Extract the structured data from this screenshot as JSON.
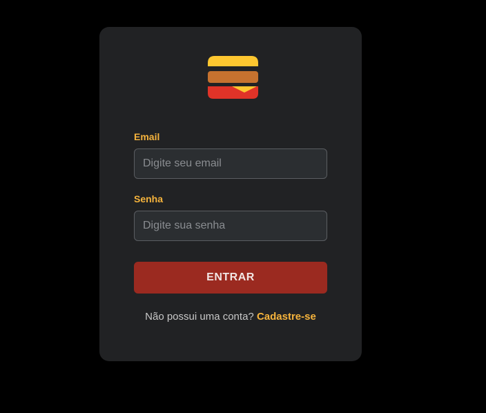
{
  "logo": {
    "icon": "burger-icon",
    "colors": {
      "bun_top": "#fdc730",
      "patty": "#c6722f",
      "cheese": "#fdc730",
      "bun_bottom": "#e03328"
    }
  },
  "form": {
    "email": {
      "label": "Email",
      "placeholder": "Digite seu email",
      "value": ""
    },
    "password": {
      "label": "Senha",
      "placeholder": "Digite sua senha",
      "value": ""
    },
    "submit_label": "ENTRAR"
  },
  "footer": {
    "prompt": "Não possui uma conta?",
    "link_label": "Cadastre-se"
  },
  "colors": {
    "accent": "#f5b33c",
    "button": "#9b2a20",
    "card": "#212224",
    "background": "#000000"
  }
}
